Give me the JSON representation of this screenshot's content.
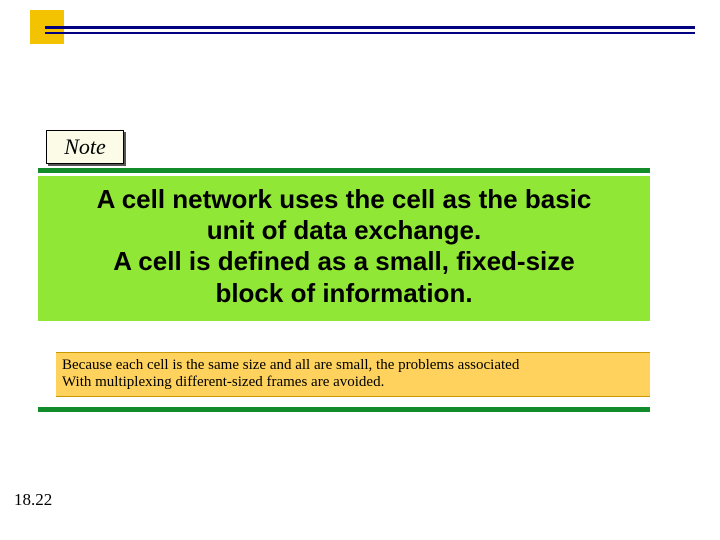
{
  "decor": {
    "square_color": "#f3c200"
  },
  "note": {
    "label": "Note"
  },
  "main": {
    "line1": "A cell network uses the cell as the basic",
    "line2": "unit of data exchange.",
    "line3": "A cell is defined as a small, fixed-size",
    "line4": "block of information."
  },
  "sub": {
    "line1": "Because each cell is the same size and all are small, the problems associated",
    "line2": "With multiplexing different-sized frames are avoided."
  },
  "page_number": "18.22"
}
